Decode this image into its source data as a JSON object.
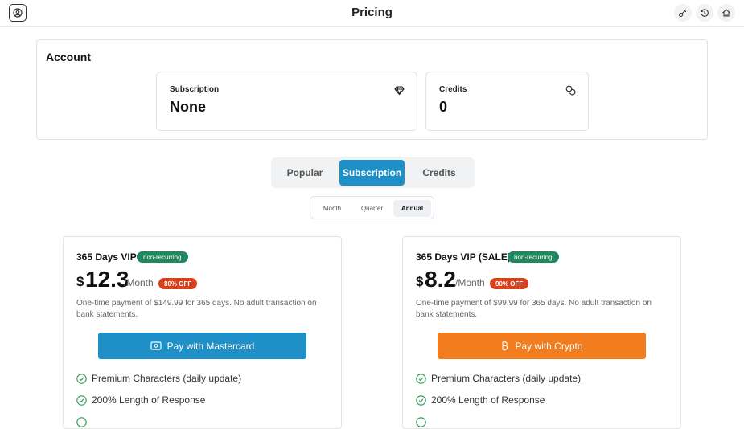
{
  "header": {
    "title": "Pricing"
  },
  "account": {
    "title": "Account",
    "subscription": {
      "label": "Subscription",
      "value": "None"
    },
    "credits": {
      "label": "Credits",
      "value": "0"
    }
  },
  "tabs": [
    {
      "label": "Popular",
      "active": false
    },
    {
      "label": "Subscription",
      "active": true
    },
    {
      "label": "Credits",
      "active": false
    }
  ],
  "periods": [
    {
      "label": "Month",
      "active": false
    },
    {
      "label": "Quarter",
      "active": false
    },
    {
      "label": "Annual",
      "active": true
    }
  ],
  "plans": [
    {
      "name": "365 Days VIP",
      "badge": "non-recurring",
      "currency": "$",
      "price": "12.3",
      "per": "/Month",
      "discount": "80% OFF",
      "description": "One-time payment of $149.99 for 365 days. No adult transaction on bank statements.",
      "pay_label": "Pay with Mastercard",
      "pay_color": "#1e8fc7",
      "features": [
        "Premium Characters (daily update)",
        "200% Length of Response"
      ]
    },
    {
      "name": "365 Days VIP (SALE)",
      "badge": "non-recurring",
      "currency": "$",
      "price": "8.2",
      "per": "/Month",
      "discount": "90% OFF",
      "description": "One-time payment of $99.99 for 365 days. No adult transaction on bank statements.",
      "pay_label": "Pay with Crypto",
      "pay_color": "#f27d1f",
      "features": [
        "Premium Characters (daily update)",
        "200% Length of Response"
      ]
    }
  ],
  "colors": {
    "accent": "#1e8fc7",
    "green_badge": "#20885f",
    "discount": "#d9401b",
    "crypto": "#f27d1f",
    "check": "#2e9a55"
  },
  "icons": {
    "avatar": "user-circle-icon",
    "key": "key-icon",
    "history": "history-icon",
    "home": "home-icon",
    "subscription": "diamond-icon",
    "credits": "coins-icon",
    "mastercard": "card-icon",
    "crypto": "bitcoin-icon",
    "check": "check-circle-icon"
  }
}
